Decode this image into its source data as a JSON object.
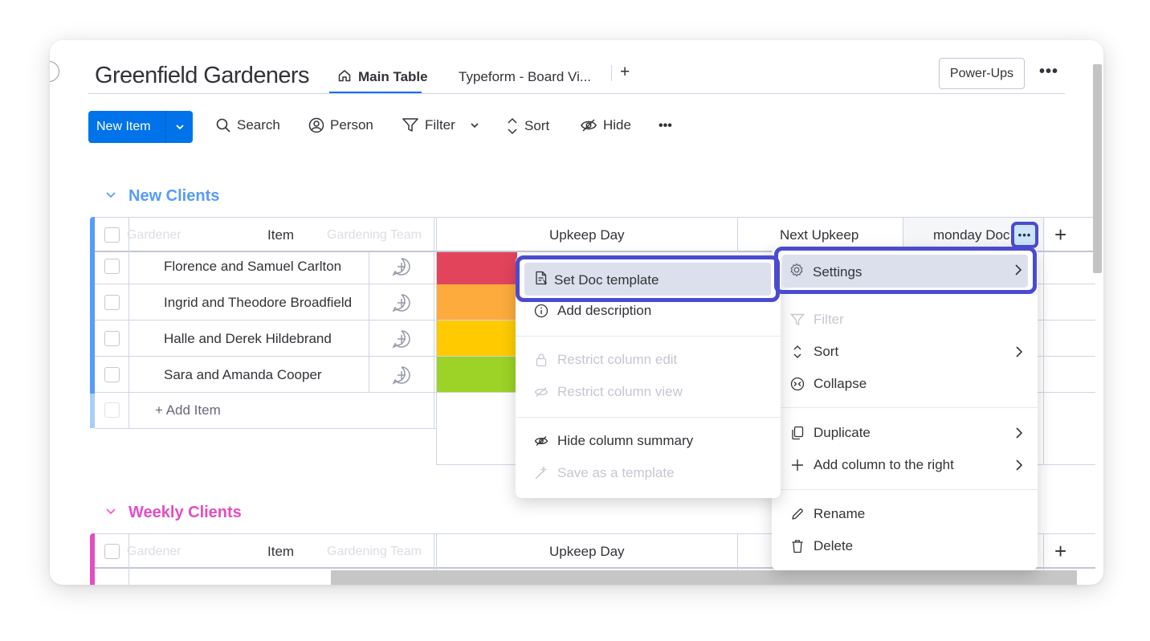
{
  "board": {
    "title": "Greenfield Gardeners"
  },
  "tabs": [
    {
      "label": "Main Table"
    },
    {
      "label": "Typeform - Board Vi..."
    }
  ],
  "tab_add_label": "+",
  "header": {
    "powerups_label": "Power-Ups",
    "more_label": "•••"
  },
  "toolbar": {
    "new_item_label": "New Item",
    "search_label": "Search",
    "person_label": "Person",
    "filter_label": "Filter",
    "sort_label": "Sort",
    "hide_label": "Hide",
    "more_label": "•••"
  },
  "group1": {
    "title": "New Clients",
    "color": "#579bfc",
    "columns": {
      "item": "Item",
      "upkeep_day": "Upkeep Day",
      "next_upkeep": "Next Upkeep",
      "monday_doc": "monday Doc"
    },
    "ghost_left": "Gardener",
    "ghost_right": "Gardening Team",
    "rows": [
      {
        "name": "Florence and Samuel Carlton",
        "status_color": "#e2445c"
      },
      {
        "name": "Ingrid and Theodore Broadfield",
        "status_color": "#fdab3d"
      },
      {
        "name": "Halle and Derek Hildebrand",
        "status_color": "#ffcb00"
      },
      {
        "name": "Sara and Amanda Cooper",
        "status_color": "#9cd326"
      }
    ],
    "add_item_label": "+ Add Item",
    "column_menu_label": "•••",
    "add_column_label": "+"
  },
  "group2": {
    "title": "Weekly Clients",
    "color": "#ff5ac4",
    "columns": {
      "item": "Item",
      "upkeep_day": "Upkeep Day"
    },
    "ghost_left": "Gardener",
    "ghost_right": "Gardening Team",
    "add_column_label": "+"
  },
  "column_menu": {
    "items": [
      {
        "label": "Settings",
        "has_submenu": true
      },
      {
        "label": "Filter",
        "disabled": true
      },
      {
        "label": "Sort",
        "has_submenu": true
      },
      {
        "label": "Collapse"
      },
      {
        "label": "Duplicate",
        "has_submenu": true
      },
      {
        "label": "Add column to the right",
        "has_submenu": true
      },
      {
        "label": "Rename"
      },
      {
        "label": "Delete"
      }
    ]
  },
  "settings_submenu": {
    "items": [
      {
        "label": "Set Doc template"
      },
      {
        "label": "Add description"
      },
      {
        "label": "Restrict column edit",
        "disabled": true
      },
      {
        "label": "Restrict column view",
        "disabled": true
      },
      {
        "label": "Hide column summary"
      },
      {
        "label": "Save as a template",
        "disabled": true
      }
    ]
  },
  "colors": {
    "primary": "#0073ea",
    "highlight": "#4b4bd0"
  }
}
